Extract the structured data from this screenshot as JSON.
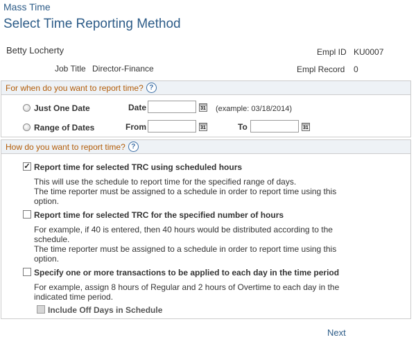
{
  "header": {
    "breadcrumb": "Mass Time",
    "title": "Select Time Reporting Method"
  },
  "employee": {
    "name": "Betty Locherty",
    "empl_id_label": "Empl ID",
    "empl_id": "KU0007",
    "job_title_label": "Job Title",
    "job_title": "Director-Finance",
    "empl_record_label": "Empl Record",
    "empl_record": "0"
  },
  "when_section": {
    "title": "For when do you want to report time?",
    "help_icon": "?",
    "option_one_date": {
      "label": "Just One Date",
      "selected": false,
      "date_label": "Date",
      "date_value": "",
      "example": "(example: 03/18/2014)"
    },
    "option_range": {
      "label": "Range of Dates",
      "selected": false,
      "from_label": "From",
      "from_value": "",
      "to_label": "To",
      "to_value": ""
    },
    "calendar_icon_text": "31"
  },
  "how_section": {
    "title": "How do you want to report time?",
    "help_icon": "?",
    "options": [
      {
        "label": "Report time for selected TRC using scheduled hours",
        "checked": "✓",
        "desc": [
          "This will use the schedule to report time for the specified range of days.",
          "The time reporter must be assigned to a schedule in order to report time using this option."
        ]
      },
      {
        "label": "Report time for selected TRC for the specified number of hours",
        "checked": "",
        "desc": [
          "For example, if 40 is entered, then 40 hours would be distributed according to the schedule.",
          "The time reporter must be assigned to a schedule in order to report time using this option."
        ]
      },
      {
        "label": "Specify one or more transactions to be applied to each day in the time period",
        "checked": "",
        "desc": [
          "For example, assign 8 hours of Regular and 2 hours of Overtime to each day in the indicated time period."
        ]
      }
    ],
    "include_off_days": {
      "label": "Include Off Days in Schedule",
      "checked": ""
    }
  },
  "footer": {
    "next_label": "Next"
  },
  "colors": {
    "title_blue": "#2d5c88",
    "section_header_orange": "#b25c08",
    "section_header_bg": "#eef2f6"
  }
}
